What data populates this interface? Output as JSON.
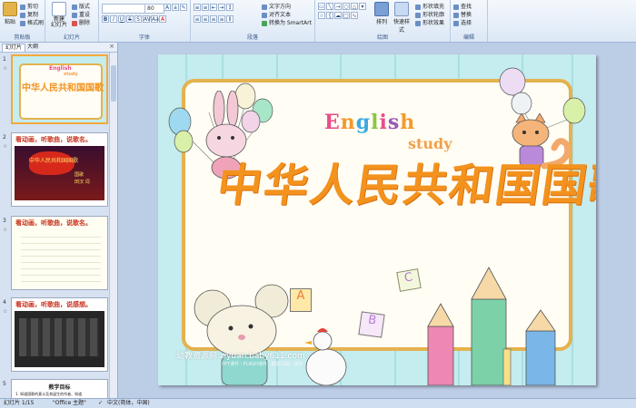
{
  "ribbon": {
    "clipboard": {
      "label": "剪贴板",
      "paste": "粘贴",
      "cut": "剪切",
      "copy": "复制",
      "format_painter": "格式刷"
    },
    "slides": {
      "label": "幻灯片",
      "new_slide": "新建\n幻灯片",
      "layout": "版式",
      "reset": "重设",
      "delete": "删除"
    },
    "font": {
      "label": "字体",
      "font_size": "80",
      "bold": "B",
      "italic": "I",
      "underline": "U",
      "strike": "S",
      "shadow": "S",
      "spacing": "AV",
      "case": "Aa",
      "color": "A"
    },
    "paragraph": {
      "label": "段落",
      "text_direction": "文字方向",
      "align_text": "对齐文本",
      "smartart": "转换为 SmartArt"
    },
    "drawing": {
      "label": "绘图",
      "arrange": "排列",
      "quick_styles": "快速样式",
      "shape_fill": "形状填充",
      "shape_outline": "形状轮廓",
      "shape_effects": "形状效果"
    },
    "editing": {
      "label": "编辑",
      "find": "查找",
      "replace": "替换",
      "select": "选择"
    }
  },
  "sidebar": {
    "tabs": [
      "幻灯片",
      "大纲"
    ],
    "close": "×",
    "slides": [
      {
        "num": "1",
        "title": ""
      },
      {
        "num": "2",
        "title": "看动画，听歌曲，说歌名。"
      },
      {
        "num": "3",
        "title": "看动画，听歌曲，说歌名。"
      },
      {
        "num": "4",
        "title": "看动画，听歌曲，说感想。"
      },
      {
        "num": "5",
        "title": "教学目标",
        "sub": "1. 知道国歌的意义及其诞生的作者、知道"
      }
    ],
    "thumb1_text": "中华人民共和国国歌",
    "thumb1_english": "English",
    "thumb1_study": "study",
    "thumb2_text": "中华人民共和国国歌",
    "thumb2_sub1": "国歌",
    "thumb2_sub2": "田汉 词"
  },
  "slide": {
    "english": [
      "E",
      "n",
      "g",
      "l",
      "i",
      "s",
      "h"
    ],
    "study": "study",
    "title": "中华人民共和国国歌",
    "letters": {
      "a": "A",
      "b": "B",
      "c": "C"
    },
    "watermark": "幼教资源网 ziyuan.baby611.com",
    "watermark_small": "PPT课件 · FLASH课件 · 教案试题 · 课件"
  },
  "status": {
    "slide_count": "幻灯片 1/15",
    "theme": "\"Office 主题\"",
    "language": "中文(简体，中国)"
  },
  "colors": {
    "english_letters": [
      "#e94b8a",
      "#f39a2b",
      "#3fa9e0",
      "#8cc63f",
      "#e94b8a",
      "#9b59b6",
      "#f39a2b"
    ],
    "title": "#f3921d",
    "board_border": "#e4b24e"
  }
}
